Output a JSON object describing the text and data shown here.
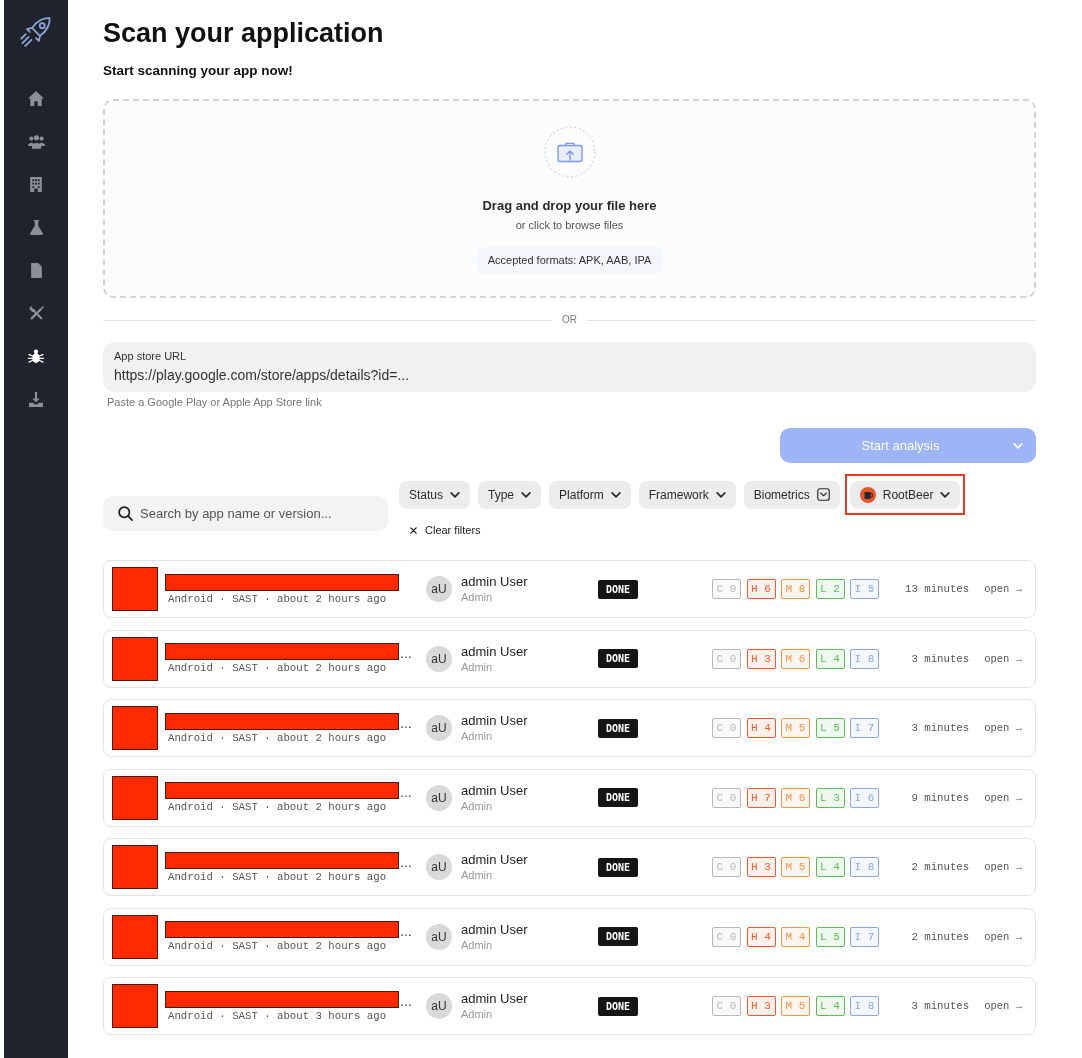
{
  "sidebar": {
    "items": [
      {
        "selected": false
      },
      {
        "selected": false
      },
      {
        "selected": false
      },
      {
        "selected": false
      },
      {
        "selected": false
      },
      {
        "selected": false
      },
      {
        "selected": true
      },
      {
        "selected": false
      }
    ]
  },
  "header": {
    "title": "Scan your application",
    "subtitle": "Start scanning your app now!"
  },
  "upload": {
    "title": "Drag and drop your file here",
    "subtitle": "or click to browse files",
    "formats": "Accepted formats: APK, AAB, IPA"
  },
  "divider": {
    "label": "OR"
  },
  "url_field": {
    "label": "App store URL",
    "value": "https://play.google.com/store/apps/details?id=...",
    "hint": "Paste a Google Play or Apple App Store link"
  },
  "start_button": {
    "label": "Start analysis",
    "disabled": true
  },
  "search": {
    "placeholder": "Search by app name or version..."
  },
  "filters": [
    {
      "label": "Status",
      "kind": "dropdown",
      "highlighted": false
    },
    {
      "label": "Type",
      "kind": "dropdown",
      "highlighted": false
    },
    {
      "label": "Platform",
      "kind": "dropdown",
      "highlighted": false
    },
    {
      "label": "Framework",
      "kind": "dropdown",
      "highlighted": false
    },
    {
      "label": "Biometrics",
      "kind": "toggle",
      "highlighted": false
    },
    {
      "label": "RootBeer",
      "kind": "logo-dropdown",
      "highlighted": true
    }
  ],
  "clear_filters": {
    "label": "Clear filters"
  },
  "rows": [
    {
      "meta": "Android · SAST · about 2 hours ago",
      "user": {
        "initials": "aU",
        "name": "admin User",
        "role": "Admin"
      },
      "status": "DONE",
      "findings": [
        {
          "label": "C",
          "count": "0",
          "color": "#b8b8b8"
        },
        {
          "label": "H",
          "count": "6",
          "color": "#f05a2c"
        },
        {
          "label": "M",
          "count": "8",
          "color": "#f4934e"
        },
        {
          "label": "L",
          "count": "2",
          "color": "#5bbf56"
        },
        {
          "label": "I",
          "count": "5",
          "color": "#89a6ee"
        }
      ],
      "duration": "13 minutes",
      "link": "open →"
    },
    {
      "name_tail": "…",
      "meta": "Android · SAST · about 2 hours ago",
      "user": {
        "initials": "aU",
        "name": "admin User",
        "role": "Admin"
      },
      "status": "DONE",
      "findings": [
        {
          "label": "C",
          "count": "0",
          "color": "#b8b8b8"
        },
        {
          "label": "H",
          "count": "3",
          "color": "#f05a2c"
        },
        {
          "label": "M",
          "count": "6",
          "color": "#f4934e"
        },
        {
          "label": "L",
          "count": "4",
          "color": "#5bbf56"
        },
        {
          "label": "I",
          "count": "8",
          "color": "#89a6ee"
        }
      ],
      "duration": "3 minutes",
      "link": "open →"
    },
    {
      "name_tail": "…",
      "meta": "Android · SAST · about 2 hours ago",
      "user": {
        "initials": "aU",
        "name": "admin User",
        "role": "Admin"
      },
      "status": "DONE",
      "findings": [
        {
          "label": "C",
          "count": "0",
          "color": "#b8b8b8"
        },
        {
          "label": "H",
          "count": "4",
          "color": "#f05a2c"
        },
        {
          "label": "M",
          "count": "5",
          "color": "#f4934e"
        },
        {
          "label": "L",
          "count": "5",
          "color": "#5bbf56"
        },
        {
          "label": "I",
          "count": "7",
          "color": "#89a6ee"
        }
      ],
      "duration": "3 minutes",
      "link": "open →"
    },
    {
      "name_tail": "…",
      "meta": "Android · SAST · about 2 hours ago",
      "user": {
        "initials": "aU",
        "name": "admin User",
        "role": "Admin"
      },
      "status": "DONE",
      "findings": [
        {
          "label": "C",
          "count": "0",
          "color": "#b8b8b8"
        },
        {
          "label": "H",
          "count": "7",
          "color": "#f05a2c"
        },
        {
          "label": "M",
          "count": "6",
          "color": "#f4934e"
        },
        {
          "label": "L",
          "count": "3",
          "color": "#5bbf56"
        },
        {
          "label": "I",
          "count": "6",
          "color": "#89a6ee"
        }
      ],
      "duration": "9 minutes",
      "link": "open →"
    },
    {
      "name_tail": "…",
      "meta": "Android · SAST · about 2 hours ago",
      "user": {
        "initials": "aU",
        "name": "admin User",
        "role": "Admin"
      },
      "status": "DONE",
      "findings": [
        {
          "label": "C",
          "count": "0",
          "color": "#b8b8b8"
        },
        {
          "label": "H",
          "count": "3",
          "color": "#f05a2c"
        },
        {
          "label": "M",
          "count": "5",
          "color": "#f4934e"
        },
        {
          "label": "L",
          "count": "4",
          "color": "#5bbf56"
        },
        {
          "label": "I",
          "count": "8",
          "color": "#89a6ee"
        }
      ],
      "duration": "2 minutes",
      "link": "open →"
    },
    {
      "name_tail": "…",
      "meta": "Android · SAST · about 2 hours ago",
      "user": {
        "initials": "aU",
        "name": "admin User",
        "role": "Admin"
      },
      "status": "DONE",
      "findings": [
        {
          "label": "C",
          "count": "0",
          "color": "#b8b8b8"
        },
        {
          "label": "H",
          "count": "4",
          "color": "#f05a2c"
        },
        {
          "label": "M",
          "count": "4",
          "color": "#f4934e"
        },
        {
          "label": "L",
          "count": "5",
          "color": "#5bbf56"
        },
        {
          "label": "I",
          "count": "7",
          "color": "#89a6ee"
        }
      ],
      "duration": "2 minutes",
      "link": "open →"
    },
    {
      "name_tail": "…",
      "meta": "Android · SAST · about 3 hours ago",
      "user": {
        "initials": "aU",
        "name": "admin User",
        "role": "Admin"
      },
      "status": "DONE",
      "findings": [
        {
          "label": "C",
          "count": "0",
          "color": "#b8b8b8"
        },
        {
          "label": "H",
          "count": "3",
          "color": "#f05a2c"
        },
        {
          "label": "M",
          "count": "5",
          "color": "#f4934e"
        },
        {
          "label": "L",
          "count": "4",
          "color": "#5bbf56"
        },
        {
          "label": "I",
          "count": "8",
          "color": "#89a6ee"
        }
      ],
      "duration": "3 minutes",
      "link": "open →"
    }
  ]
}
